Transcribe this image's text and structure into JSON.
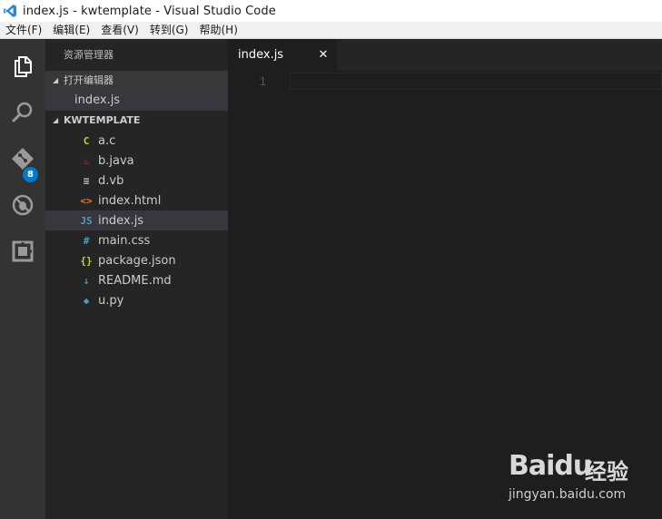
{
  "window": {
    "title": "index.js - kwtemplate - Visual Studio Code"
  },
  "menu": [
    "文件(F)",
    "编辑(E)",
    "查看(V)",
    "转到(G)",
    "帮助(H)"
  ],
  "activity": {
    "scm_badge": "8"
  },
  "explorer": {
    "title": "资源管理器",
    "open_editors_label": "打开编辑器",
    "open_editors": [
      "index.js"
    ],
    "folder_label": "KWTEMPLATE",
    "files": [
      {
        "name": "a.c",
        "icon": "c-file-icon",
        "glyph": "C",
        "color": "#cbcb41"
      },
      {
        "name": "b.java",
        "icon": "java-file-icon",
        "glyph": "♨",
        "color": "#cc3e44"
      },
      {
        "name": "d.vb",
        "icon": "text-file-icon",
        "glyph": "≡",
        "color": "#cccccc"
      },
      {
        "name": "index.html",
        "icon": "html-file-icon",
        "glyph": "<>",
        "color": "#e37933"
      },
      {
        "name": "index.js",
        "icon": "js-file-icon",
        "glyph": "JS",
        "color": "#519aba"
      },
      {
        "name": "main.css",
        "icon": "css-file-icon",
        "glyph": "#",
        "color": "#519aba"
      },
      {
        "name": "package.json",
        "icon": "json-file-icon",
        "glyph": "{}",
        "color": "#cbcb41"
      },
      {
        "name": "README.md",
        "icon": "markdown-file-icon",
        "glyph": "↓",
        "color": "#519aba"
      },
      {
        "name": "u.py",
        "icon": "python-file-icon",
        "glyph": "◆",
        "color": "#519aba"
      }
    ],
    "selected_file": "index.js"
  },
  "tab": {
    "label": "index.js",
    "close": "✕"
  },
  "editor": {
    "line_number": "1"
  },
  "watermark": {
    "brand": "Baidu",
    "cn": "经验",
    "url": "jingyan.baidu.com"
  }
}
